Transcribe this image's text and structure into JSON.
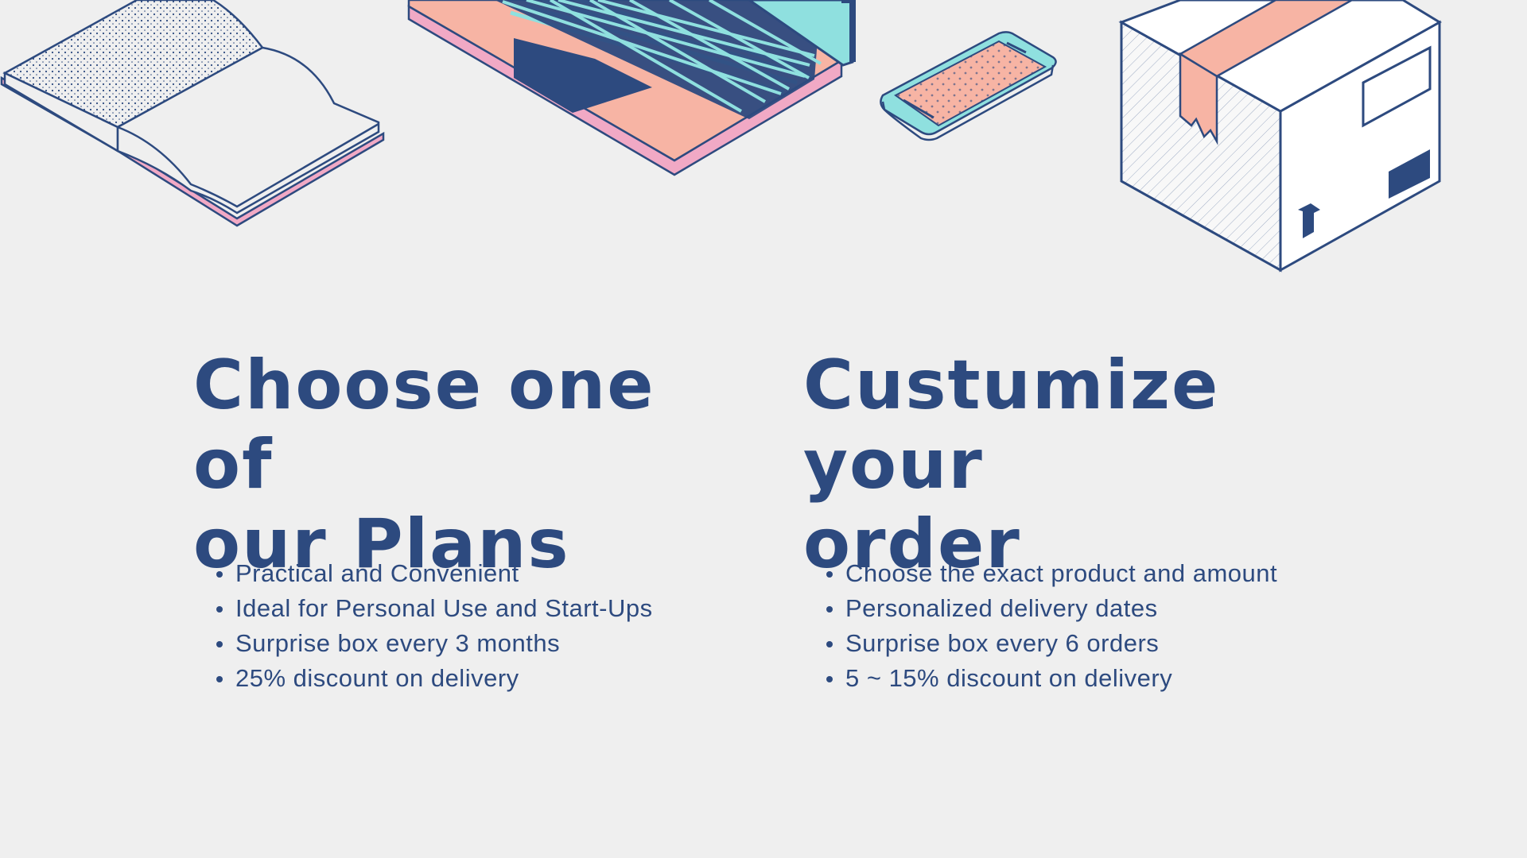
{
  "colors": {
    "background": "#efefef",
    "navy": "#2d4a7f",
    "salmon": "#f7b4a4",
    "pink": "#f1a9c5",
    "cyan": "#8fe0df"
  },
  "icons": [
    "open-book-icon",
    "laptop-icon",
    "smartphone-icon",
    "shipping-box-icon"
  ],
  "plans": {
    "heading_line1": "Choose one of",
    "heading_line2": "our Plans",
    "features": [
      "Practical and Convenient",
      "Ideal for Personal Use and Start-Ups",
      "Surprise box every 3 months",
      "25% discount on delivery"
    ]
  },
  "custom": {
    "heading_line1": "Custumize your",
    "heading_line2": "order",
    "features": [
      "Choose the exact product and amount",
      "Personalized delivery dates",
      "Surprise box every 6 orders",
      "5 ~ 15% discount on delivery"
    ]
  }
}
